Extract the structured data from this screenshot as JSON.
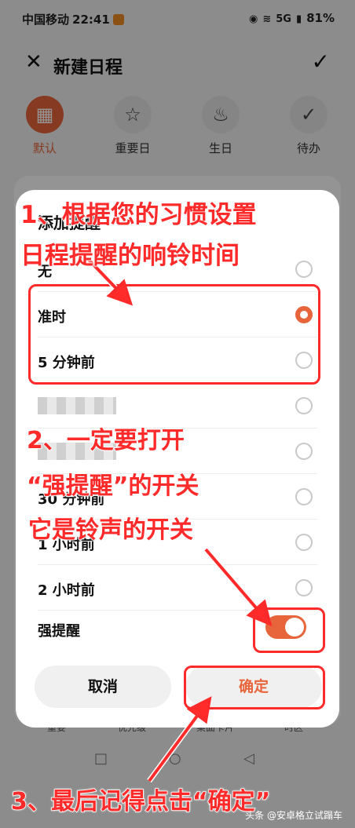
{
  "status_bar": {
    "carrier": "中国移动",
    "time": "22:41",
    "network": "5G",
    "battery": "81%"
  },
  "header": {
    "title": "新建日程"
  },
  "schedule_types": [
    {
      "label": "默认",
      "icon": "calendar-icon",
      "active": true
    },
    {
      "label": "重要日",
      "icon": "star-icon",
      "active": false
    },
    {
      "label": "生日",
      "icon": "cake-icon",
      "active": false
    },
    {
      "label": "待办",
      "icon": "check-circle-icon",
      "active": false
    }
  ],
  "dialog": {
    "title": "添加提醒",
    "options": [
      {
        "label": "无",
        "selected": false
      },
      {
        "label": "准时",
        "selected": true
      },
      {
        "label": "5 分钟前",
        "selected": false
      },
      {
        "label": "",
        "selected": false
      },
      {
        "label": "",
        "selected": false
      },
      {
        "label": "30 分钟前",
        "selected": false
      },
      {
        "label": "1 小时前",
        "selected": false
      },
      {
        "label": "2 小时前",
        "selected": false
      }
    ],
    "strong_reminder_label": "强提醒",
    "strong_reminder_on": true,
    "cancel_label": "取消",
    "confirm_label": "确定"
  },
  "background_bottom": [
    "重要",
    "优先级",
    "桌面卡片",
    "时区"
  ],
  "annotations": {
    "step1_line1": "1、根据您的习惯设置",
    "step1_line2": "日程提醒的响铃时间",
    "step2_line1": "2、一定要打开",
    "step2_line2": "“强提醒”的开关",
    "step2_line3": "它是铃声的开关",
    "step3": "3、最后记得点击“确定”"
  },
  "watermark": "头条 @安卓格立试蹋车",
  "colors": {
    "accent": "#e8653c",
    "annotation": "#ff2a2a"
  }
}
